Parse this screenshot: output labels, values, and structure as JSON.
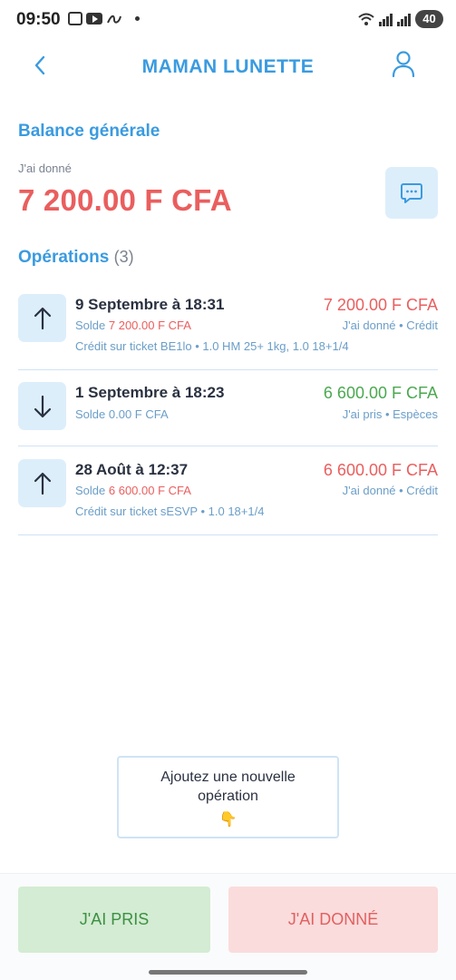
{
  "status_bar": {
    "time": "09:50",
    "battery": "40"
  },
  "header": {
    "title": "MAMAN LUNETTE"
  },
  "balance": {
    "title": "Balance générale",
    "label": "J'ai donné",
    "amount": "7 200.00 F CFA"
  },
  "operations": {
    "title": "Opérations",
    "count": "(3)",
    "items": [
      {
        "date": "9 Septembre à 18:31",
        "amount": "7 200.00 F CFA",
        "solde_label": "Solde",
        "solde_value": "7 200.00 F CFA",
        "type": "J'ai donné • Crédit",
        "detail": "Crédit sur ticket BE1lo • 1.0 HM  25+ 1kg, 1.0 18+1/4",
        "direction": "up"
      },
      {
        "date": "1 Septembre à 18:23",
        "amount": "6 600.00 F CFA",
        "solde_label": "Solde",
        "solde_value": "0.00 F CFA",
        "type": "J'ai pris • Espèces",
        "detail": "",
        "direction": "down"
      },
      {
        "date": "28 Août à 12:37",
        "amount": "6 600.00 F CFA",
        "solde_label": "Solde",
        "solde_value": "6 600.00 F CFA",
        "type": "J'ai donné • Crédit",
        "detail": "Crédit sur ticket sESVP • 1.0 18+1/4",
        "direction": "up"
      }
    ]
  },
  "add_operation": {
    "label": "Ajoutez une nouvelle opération",
    "icon": "👇"
  },
  "actions": {
    "pris": "J'AI PRIS",
    "donne": "J'AI DONNÉ"
  },
  "colors": {
    "accent": "#3a9be0",
    "negative": "#ea5e5e",
    "positive": "#4aa84f"
  }
}
